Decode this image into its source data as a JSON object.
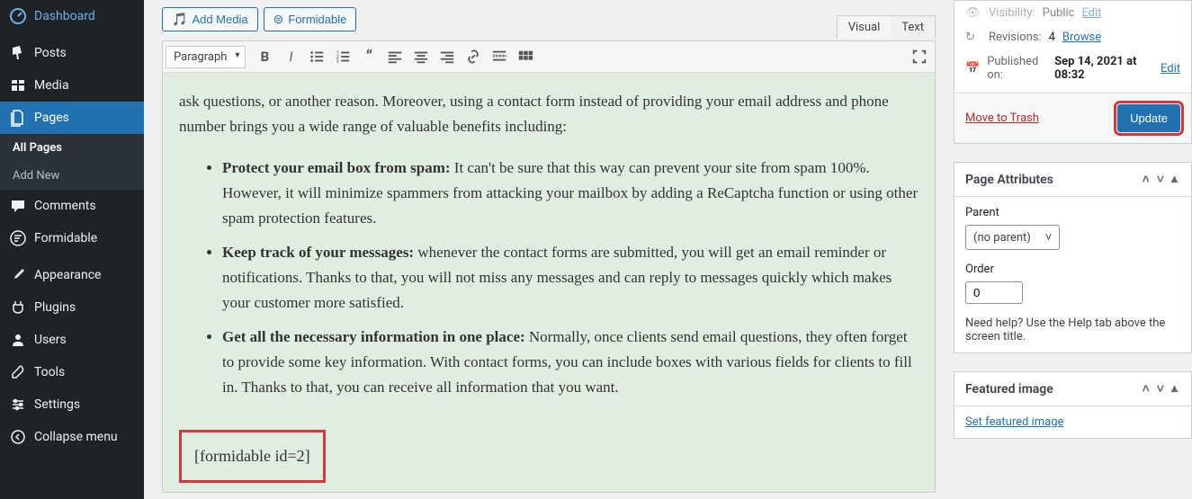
{
  "sidebar": {
    "items": [
      {
        "label": "Dashboard",
        "icon": "dashboard"
      },
      {
        "label": "Posts",
        "icon": "pin"
      },
      {
        "label": "Media",
        "icon": "media"
      },
      {
        "label": "Pages",
        "icon": "pages",
        "active": true
      },
      {
        "label": "Comments",
        "icon": "comment"
      },
      {
        "label": "Formidable",
        "icon": "formidable"
      },
      {
        "label": "Appearance",
        "icon": "brush"
      },
      {
        "label": "Plugins",
        "icon": "plug"
      },
      {
        "label": "Users",
        "icon": "user"
      },
      {
        "label": "Tools",
        "icon": "wrench"
      },
      {
        "label": "Settings",
        "icon": "sliders"
      },
      {
        "label": "Collapse menu",
        "icon": "collapse"
      }
    ],
    "sub": {
      "all": "All Pages",
      "add": "Add New"
    }
  },
  "topButtons": {
    "addMedia": "Add Media",
    "formidable": "Formidable"
  },
  "editor": {
    "tabs": {
      "visual": "Visual",
      "text": "Text"
    },
    "dropdown": "Paragraph",
    "body": {
      "intro": "ask questions, or another reason. Moreover, using a contact form instead of providing your email address and phone number brings you a wide range of valuable benefits including:",
      "b1_bold": "Protect your email box from spam:",
      "b1_rest": " It can't be sure that this way can prevent your site from spam 100%. However, it will minimize spammers from attacking your mailbox by adding a ReCaptcha function or using other spam protection features.",
      "b2_bold": "Keep track of your messages:",
      "b2_rest": " whenever the contact forms are submitted, you will get an email reminder or notifications. Thanks to that, you will not miss any messages and can reply to messages quickly which makes your customer more satisfied.",
      "b3_bold": "Get all the necessary information in one place:",
      "b3_rest": " Normally, once clients send email questions, they often forget to provide some key information. With contact forms, you can include boxes with various fields for clients to fill in. Thanks to that, you can receive all information that you want.",
      "shortcode": "[formidable id=2]"
    }
  },
  "publish": {
    "visibilityLabel": "Visibility:",
    "visibilityVal": "Public",
    "visibilityEdit": "Edit",
    "revisionsLabel": "Revisions:",
    "revisionsCount": "4",
    "browse": "Browse",
    "publishedLabel": "Published on:",
    "publishedVal": "Sep 14, 2021 at 08:32",
    "publishedEdit": "Edit",
    "trash": "Move to Trash",
    "update": "Update"
  },
  "pageAttr": {
    "title": "Page Attributes",
    "parentLabel": "Parent",
    "parentVal": "(no parent)",
    "orderLabel": "Order",
    "orderVal": "0",
    "help": "Need help? Use the Help tab above the screen title."
  },
  "featured": {
    "title": "Featured image",
    "link": "Set featured image"
  }
}
